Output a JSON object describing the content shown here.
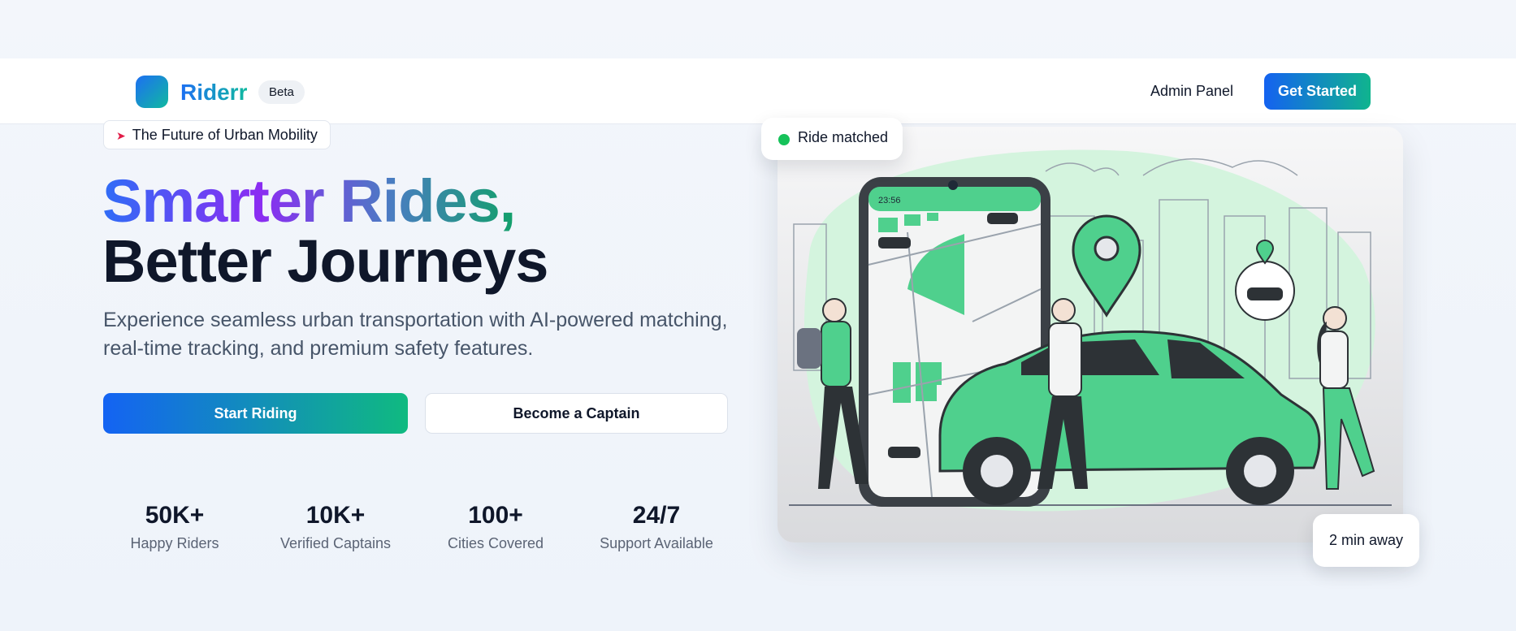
{
  "header": {
    "brand": "Riderr",
    "badge": "Beta",
    "admin_link": "Admin Panel",
    "cta": "Get Started"
  },
  "hero": {
    "pill_icon": "rocket-icon",
    "pill_text": "The Future of Urban Mobility",
    "headline_1": "Smarter Rides,",
    "headline_2": "Better Journeys",
    "subtitle": "Experience seamless urban transportation with AI-powered matching, real-time tracking, and premium safety features.",
    "primary_button": "Start Riding",
    "secondary_button": "Become a Captain"
  },
  "stats": [
    {
      "value": "50K+",
      "label": "Happy Riders"
    },
    {
      "value": "10K+",
      "label": "Verified Captains"
    },
    {
      "value": "100+",
      "label": "Cities Covered"
    },
    {
      "value": "24/7",
      "label": "Support Available"
    }
  ],
  "illustration": {
    "phone_time": "23:56",
    "badge_matched": "Ride matched",
    "badge_eta": "2 min away"
  },
  "colors": {
    "brand_blue": "#1d6ff2",
    "brand_green": "#10b9a0",
    "accent_green": "#4fd08d",
    "status_green": "#16c25a"
  }
}
